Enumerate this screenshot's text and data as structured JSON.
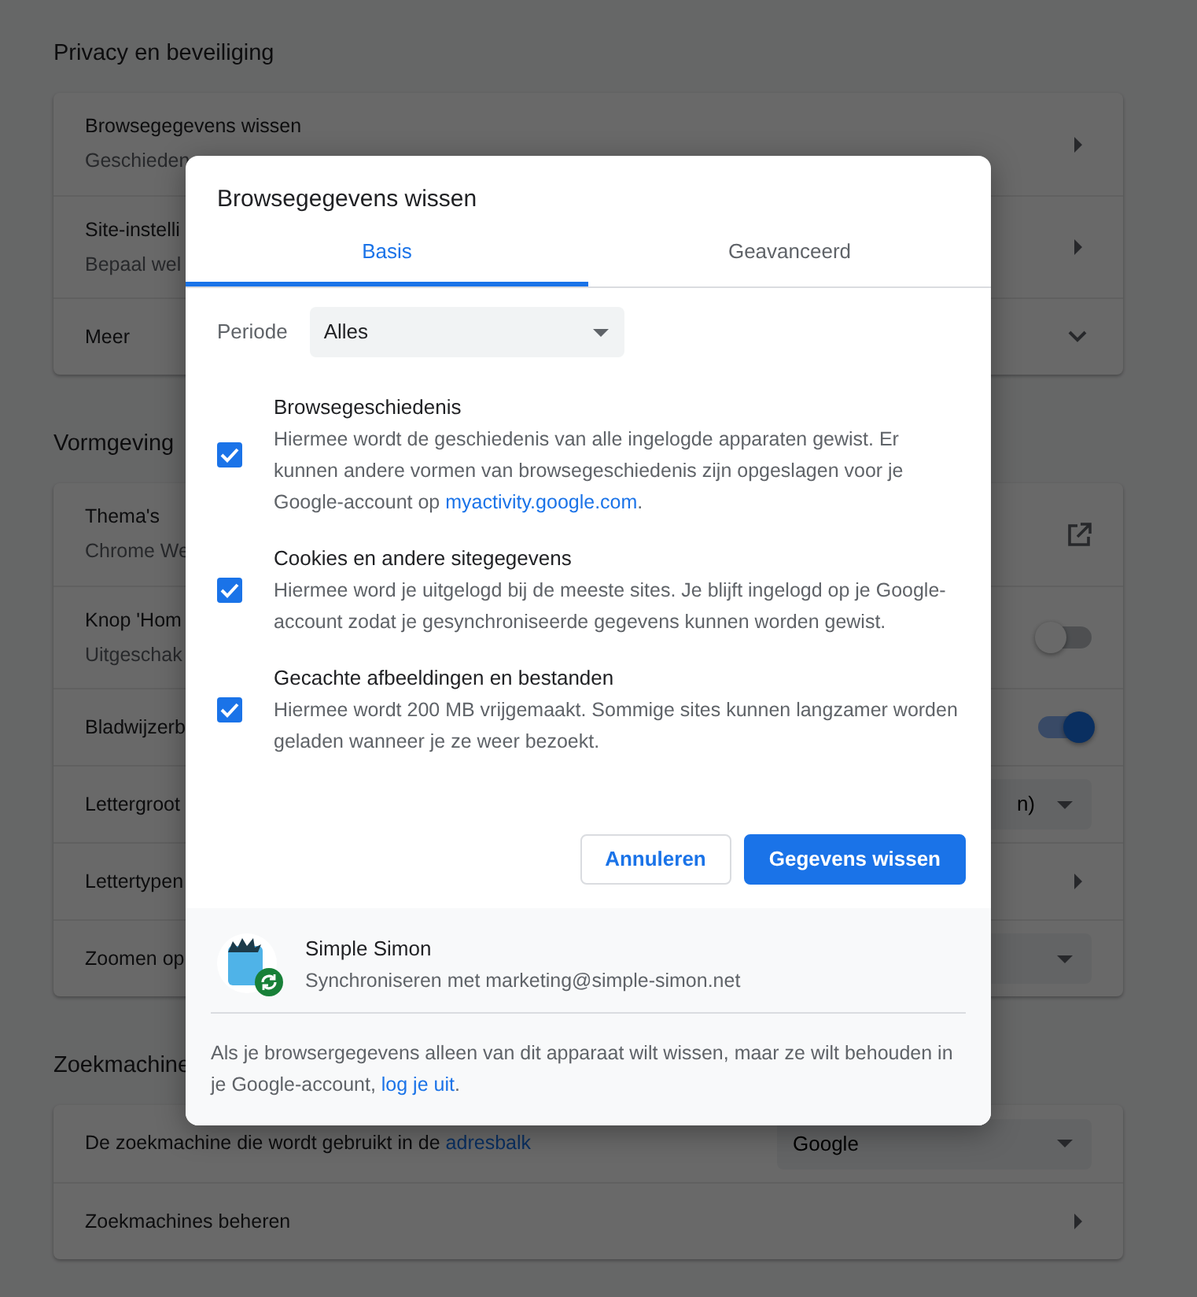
{
  "settings": {
    "sections": [
      {
        "title": "Privacy en beveiliging",
        "rows": [
          {
            "kind": "arrow",
            "title": "Browsegegevens wissen",
            "subtitle": "Geschieden"
          },
          {
            "kind": "arrow",
            "title": "Site-instelli",
            "subtitle": "Bepaal wel"
          },
          {
            "kind": "expand",
            "title": "Meer"
          }
        ]
      },
      {
        "title": "Vormgeving",
        "rows": [
          {
            "kind": "external",
            "title": "Thema's",
            "subtitle": "Chrome We"
          },
          {
            "kind": "toggle",
            "title": "Knop 'Hom",
            "subtitle": "Uitgeschak",
            "on": false
          },
          {
            "kind": "toggle",
            "title": "Bladwijzerb",
            "on": true
          },
          {
            "kind": "select",
            "title": "Lettergroot",
            "value": "n)"
          },
          {
            "kind": "arrow",
            "title": "Lettertypen"
          },
          {
            "kind": "select",
            "title": "Zoomen op"
          }
        ]
      },
      {
        "title": "Zoekmachine",
        "rows": [
          {
            "kind": "select",
            "title": "De zoekmachine die wordt gebruikt in de",
            "link": "adresbalk",
            "value": "Google"
          },
          {
            "kind": "arrow",
            "title": "Zoekmachines beheren"
          }
        ]
      }
    ]
  },
  "dialog": {
    "title": "Browsegegevens wissen",
    "tabs": [
      {
        "label": "Basis",
        "selected": true
      },
      {
        "label": "Geavanceerd",
        "selected": false
      }
    ],
    "period": {
      "label": "Periode",
      "value": "Alles"
    },
    "options": [
      {
        "title": "Browsegeschiedenis",
        "description": "Hiermee wordt de geschiedenis van alle ingelogde apparaten gewist. Er kunnen andere vormen van browsegeschiedenis zijn opgeslagen voor je Google-account op",
        "link": "myactivity.google.com",
        "description_end": ".",
        "checked": true
      },
      {
        "title": "Cookies en andere sitegegevens",
        "description": "Hiermee word je uitgelogd bij de meeste sites. Je blijft ingelogd op je Google-account zodat je gesynchroniseerde gegevens kunnen worden gewist.",
        "checked": true
      },
      {
        "title": "Gecachte afbeeldingen en bestanden",
        "description": "Hiermee wordt 200 MB vrijgemaakt. Sommige sites kunnen langzamer worden geladen wanneer je ze weer bezoekt.",
        "checked": true
      }
    ],
    "buttons": [
      {
        "label": "Annuleren",
        "kind": "secondary"
      },
      {
        "label": "Gegevens wissen",
        "kind": "primary"
      }
    ],
    "account": {
      "name": "Simple Simon",
      "sync": "Synchroniseren met marketing@simple-simon.net"
    },
    "footer": {
      "text": "Als je browsergegevens alleen van dit apparaat wilt wissen, maar ze wilt behouden in je Google-account,",
      "link": "log je uit",
      "end": "."
    }
  }
}
